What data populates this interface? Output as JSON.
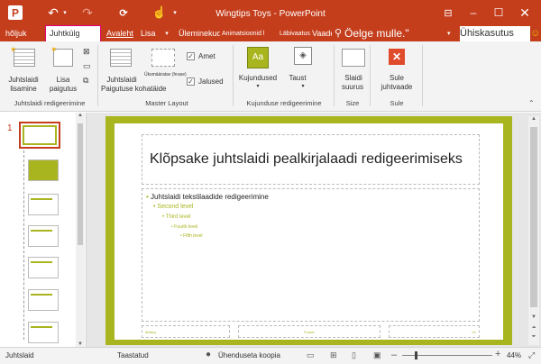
{
  "window": {
    "title": "Wingtips Toys - PowerPoint",
    "accent": "#c43e1c"
  },
  "tabs": {
    "file": "hõljuk",
    "active": "Juhtkülg",
    "home": "Avaleht",
    "insert": "Lisa",
    "transitions": "Üleminekud",
    "animations": "Animatsioonid l",
    "review": "Läbivaatus",
    "view": "Vaade",
    "tellme": "Öelge mulle.\"",
    "share": "Ühiskasutus"
  },
  "ribbon": {
    "insert_master_1": "Juhtslaidi",
    "insert_master_2": "lisamine",
    "insert_layout_1": "Lisa",
    "insert_layout_2": "paigutus",
    "master_layout_1": "Juhtslaidi",
    "master_layout_2": "Paigutuse kohatäide",
    "placeholder_small": "Üksmääratav (hrase)",
    "title_checkbox": "Amet",
    "footers_checkbox": "Jalused",
    "themes": "Kujundused",
    "background": "Taust",
    "slide_size_1": "Slaidi",
    "slide_size_2": "suurus",
    "close_1": "Sule",
    "close_2": "juhtvaade",
    "group_edit_master": "Juhtslaidi redigeerimine",
    "group_master_layout": "Master Layout",
    "group_edit_theme": "Kujunduse redigeerimine",
    "group_size": "Size",
    "group_close": "Sule"
  },
  "thumbnails": {
    "first_number": "1"
  },
  "slide": {
    "title": "Klõpsake juhtslaidi pealkirjalaadi redigeerimiseks",
    "level1": "Juhtslaidi tekstilaadide redigeerimine",
    "level2": "Second level",
    "level3": "Third level",
    "level4": "Fourth level",
    "level5": "Fifth level",
    "footer_date": "dfdssq",
    "footer_center": "Footer",
    "footer_num": "‹#›",
    "accent": "#a9b51e"
  },
  "status": {
    "view": "Juhtslaid",
    "restored": "Taastatud",
    "offline": "Ühenduseta koopia",
    "zoom": "44%"
  }
}
